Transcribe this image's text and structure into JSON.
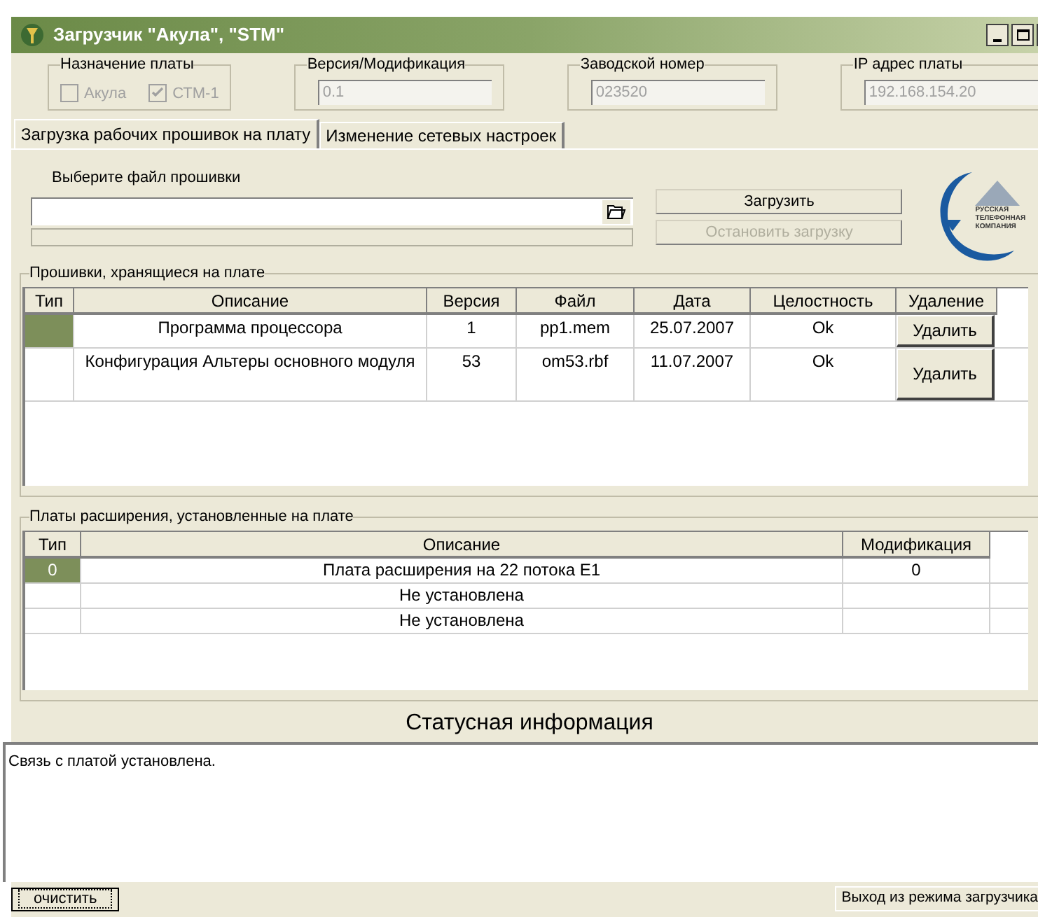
{
  "window": {
    "title": "Загрузчик \"Акула\", \"STM\""
  },
  "groups": [
    {
      "kind": "checks",
      "label": "Назначение платы",
      "checks": [
        {
          "label": "Акула",
          "checked": false
        },
        {
          "label": "СТМ-1",
          "checked": true
        }
      ]
    },
    {
      "kind": "field",
      "label": "Версия/Модификация",
      "value": "0.1"
    },
    {
      "kind": "field",
      "label": "Заводской номер",
      "value": "023520"
    },
    {
      "kind": "field",
      "label": "IP адрес платы",
      "value": "192.168.154.20"
    }
  ],
  "tabs": [
    {
      "label": "Загрузка рабочих прошивок на плату",
      "selected": true
    },
    {
      "label": "Изменение сетевых настроек",
      "selected": false
    }
  ],
  "upload": {
    "file_label": "Выберите файл прошивки",
    "progress": {
      "level": 0
    },
    "buttons": [
      {
        "label": "Загрузить",
        "disabled": false
      },
      {
        "label": "Остановить загрузку",
        "disabled": true
      }
    ]
  },
  "logo": {
    "lines": [
      "РУССКАЯ",
      "ТЕЛЕФОННАЯ",
      "КОМПАНИЯ"
    ]
  },
  "stored": {
    "title": "Прошивки, хранящиеся на плате",
    "columns": [
      "Тип",
      "Описание",
      "Версия",
      "Файл",
      "Дата",
      "Целостность",
      "Удаление"
    ],
    "rows": [
      {
        "selected": true,
        "cells": [
          "",
          "Программа процессора",
          "1",
          "pp1.mem",
          "25.07.2007",
          "Ok"
        ],
        "action": "Удалить"
      },
      {
        "selected": false,
        "cells": [
          "",
          "Конфигурация Альтеры основного модуля",
          "53",
          "om53.rbf",
          "11.07.2007",
          "Ok"
        ],
        "action": "Удалить"
      }
    ]
  },
  "expansion": {
    "title": "Платы расширения, установленные на плате",
    "columns": [
      "Тип",
      "Описание",
      "Модификация"
    ],
    "rows": [
      {
        "selected": true,
        "type": "0",
        "description": "Плата расширения на 22 потока E1",
        "modification": "0"
      },
      {
        "selected": false,
        "description": "Не установлена"
      },
      {
        "selected": false,
        "description": "Не установлена"
      }
    ]
  },
  "status": {
    "heading": "Статусная информация",
    "lines": [
      "Связь с платой установлена."
    ]
  },
  "footer": {
    "clear_button": "очистить",
    "exit_button": "Выход из режима загрузчика"
  }
}
